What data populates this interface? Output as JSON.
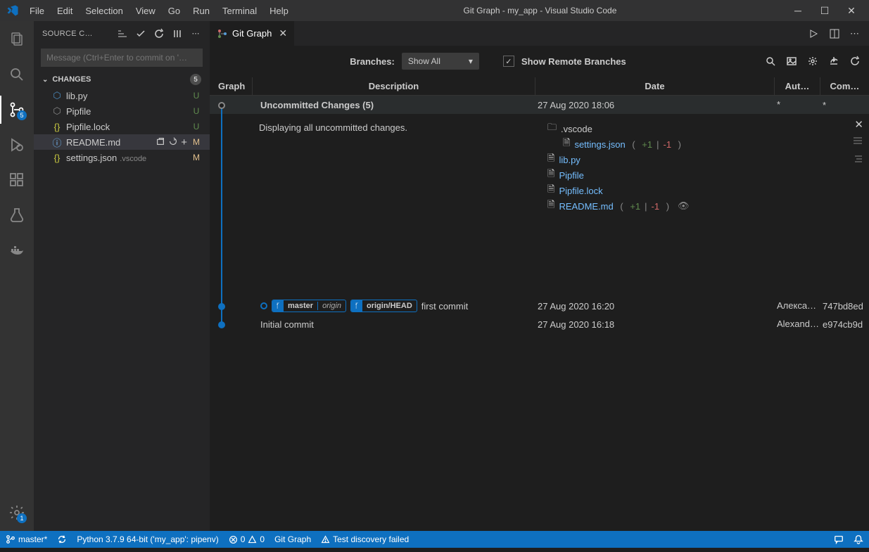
{
  "menu": {
    "file": "File",
    "edit": "Edit",
    "selection": "Selection",
    "view": "View",
    "go": "Go",
    "run": "Run",
    "terminal": "Terminal",
    "help": "Help"
  },
  "title": "Git Graph - my_app - Visual Studio Code",
  "activity": {
    "scm_badge": "5",
    "settings_badge": "1"
  },
  "sidebar": {
    "title": "SOURCE C…",
    "msg_placeholder": "Message (Ctrl+Enter to commit on '…",
    "changes_label": "CHANGES",
    "changes_count": "5",
    "files": [
      {
        "icon": "py",
        "name": "lib.py",
        "status": "U",
        "cls": "status-U"
      },
      {
        "icon": "pip",
        "name": "Pipfile",
        "status": "U",
        "cls": "status-U"
      },
      {
        "icon": "json",
        "name": "Pipfile.lock",
        "status": "U",
        "cls": "status-U"
      },
      {
        "icon": "info",
        "name": "README.md",
        "status": "M",
        "cls": "status-M",
        "selected": true,
        "actions": true
      },
      {
        "icon": "json",
        "name": "settings.json",
        "folder": ".vscode",
        "status": "M",
        "cls": "status-M"
      }
    ]
  },
  "tab": {
    "label": "Git Graph"
  },
  "gg": {
    "branches_label": "Branches:",
    "branches_value": "Show All",
    "show_remote": "Show Remote Branches",
    "cols": {
      "graph": "Graph",
      "desc": "Description",
      "date": "Date",
      "author": "Aut…",
      "commit": "Com…"
    },
    "rows": [
      {
        "kind": "uncommitted",
        "desc": "Uncommitted Changes (5)",
        "date": "27 Aug 2020 18:06",
        "author": "*",
        "commit": "*"
      },
      {
        "kind": "commit",
        "refs": [
          {
            "name": "master",
            "origin": "origin"
          },
          {
            "name": "origin/HEAD"
          }
        ],
        "desc": "first commit",
        "date": "27 Aug 2020 16:20",
        "author": "Алекса…",
        "commit": "747bd8ed"
      },
      {
        "kind": "commit",
        "desc": "Initial commit",
        "date": "27 Aug 2020 16:18",
        "author": "Alexand…",
        "commit": "e974cb9d"
      }
    ],
    "detail_msg": "Displaying all uncommitted changes.",
    "tree": {
      "folder": ".vscode",
      "folder_file": {
        "name": "settings.json",
        "diff": "( +1 | -1 )"
      },
      "files": [
        "lib.py",
        "Pipfile",
        "Pipfile.lock"
      ],
      "readme": {
        "name": "README.md",
        "diff": "( +1 | -1 )"
      }
    }
  },
  "status": {
    "branch": "master*",
    "python": "Python 3.7.9 64-bit ('my_app': pipenv)",
    "errors": "0",
    "warnings": "0",
    "gitgraph": "Git Graph",
    "test": "Test discovery failed"
  }
}
